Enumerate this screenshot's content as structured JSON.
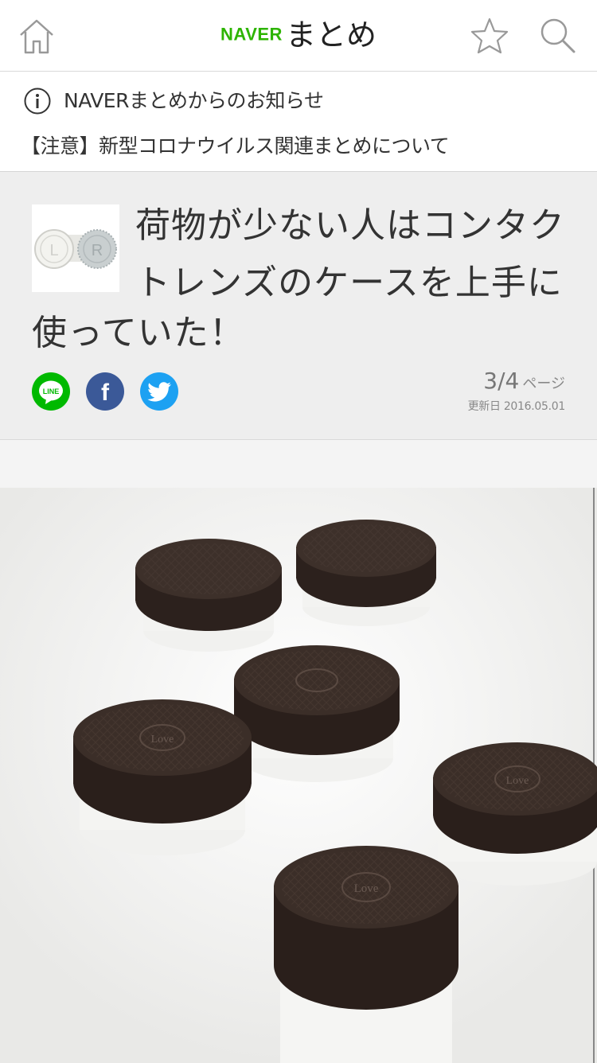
{
  "header": {
    "logo_naver": "NAVER",
    "logo_matome": "まとめ",
    "brand_color": "#2db400",
    "icons": [
      "home-icon",
      "star-icon",
      "search-icon"
    ]
  },
  "notice": {
    "title": "NAVERまとめからのお知らせ",
    "link": "【注意】新型コロナウイルス関連まとめについて",
    "icon": "info-icon"
  },
  "article": {
    "title_first": "荷物が少ない人はコンタクトレンズのケースを上手に",
    "title_rest": "使っていた！",
    "thumbnail_letters": [
      "L",
      "R"
    ],
    "share": {
      "line_label": "LINE",
      "facebook_label": "f",
      "twitter_icon": "twitter-bird-icon",
      "colors": {
        "line": "#00b900",
        "facebook": "#3b5998",
        "twitter": "#1da1f2"
      }
    },
    "page": {
      "current": "3",
      "separator": "/",
      "total": "4",
      "unit": "ページ"
    },
    "updated": "更新日 2016.05.01"
  },
  "photo": {
    "subject": "cookie-contact-lens-cases",
    "cap_text": "Love"
  }
}
